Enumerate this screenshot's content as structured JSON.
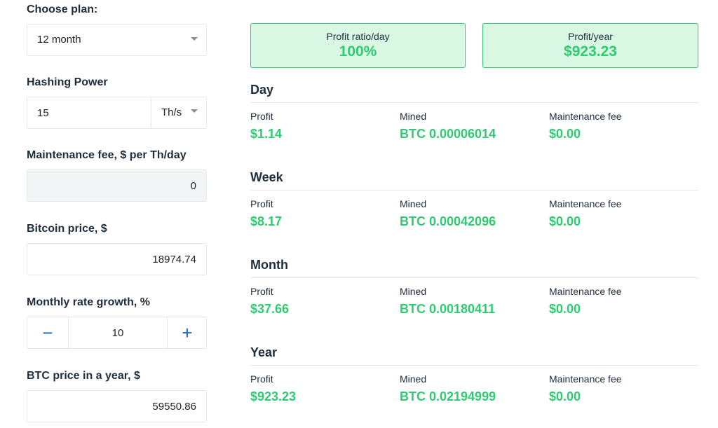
{
  "form": {
    "plan_label": "Choose plan:",
    "plan_value": "12 month",
    "hashing_label": "Hashing Power",
    "hashing_value": "15",
    "hashing_unit": "Th/s",
    "maintenance_label": "Maintenance fee, $ per Th/day",
    "maintenance_value": "0",
    "btc_price_label": "Bitcoin price, $",
    "btc_price_value": "18974.74",
    "growth_label": "Monthly rate growth, %",
    "growth_value": "10",
    "growth_minus": "−",
    "growth_plus": "+",
    "btc_year_label": "BTC price in a year, $",
    "btc_year_value": "59550.86"
  },
  "summary": {
    "ratio_label": "Profit ratio/day",
    "ratio_value": "100%",
    "year_label": "Profit/year",
    "year_value": "$923.23"
  },
  "periods": [
    {
      "title": "Day",
      "profit_label": "Profit",
      "profit": "$1.14",
      "mined_label": "Mined",
      "mined": "BTC 0.00006014",
      "fee_label": "Maintenance fee",
      "fee": "$0.00"
    },
    {
      "title": "Week",
      "profit_label": "Profit",
      "profit": "$8.17",
      "mined_label": "Mined",
      "mined": "BTC 0.00042096",
      "fee_label": "Maintenance fee",
      "fee": "$0.00"
    },
    {
      "title": "Month",
      "profit_label": "Profit",
      "profit": "$37.66",
      "mined_label": "Mined",
      "mined": "BTC 0.00180411",
      "fee_label": "Maintenance fee",
      "fee": "$0.00"
    },
    {
      "title": "Year",
      "profit_label": "Profit",
      "profit": "$923.23",
      "mined_label": "Mined",
      "mined": "BTC 0.02194999",
      "fee_label": "Maintenance fee",
      "fee": "$0.00"
    }
  ],
  "colors": {
    "accent_green": "#2ecc71",
    "box_bg": "#d9f8e4",
    "stepper_blue": "#1565c0",
    "text_dark": "#1f2d3d"
  },
  "icons": {
    "dropdown": "chevron-down-icon",
    "minus": "minus-icon",
    "plus": "plus-icon"
  }
}
